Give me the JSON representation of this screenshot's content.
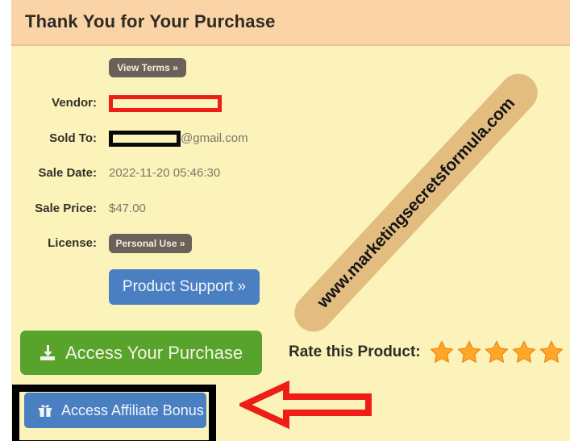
{
  "page": {
    "background_color": "#ffffff",
    "card_background": "#fbf3b9",
    "header_background": "#fad4a7"
  },
  "header": {
    "title": "Thank You for Your Purchase"
  },
  "terms": {
    "label": "View Terms »"
  },
  "details": {
    "rows": [
      {
        "label": "Vendor:",
        "value": "",
        "redacted": "red-box"
      },
      {
        "label": "Sold To:",
        "value": "@gmail.com",
        "redacted": "black-box"
      },
      {
        "label": "Sale Date:",
        "value": "2022-11-20 05:46:30",
        "redacted": ""
      },
      {
        "label": "Sale Price:",
        "value": "$47.00",
        "redacted": ""
      },
      {
        "label": "License:",
        "value": "Personal Use »",
        "redacted": ""
      }
    ]
  },
  "buttons": {
    "product_support": {
      "label": "Product Support »",
      "color": "#4a7fc1"
    },
    "access_purchase": {
      "label": "Access Your Purchase",
      "icon": "download-icon",
      "color": "#57a32c"
    },
    "access_bonus": {
      "label": "Access Affiliate Bonus",
      "icon": "gift-icon",
      "color": "#4a7fc1"
    }
  },
  "rating": {
    "label": "Rate this Product:",
    "star_count": 5,
    "star_color": "#ffa726"
  },
  "watermark": {
    "text": "www.marketingsecretsformula.com",
    "band_color": "#e3bd80"
  },
  "annotations": {
    "highlight_rect_color": "#000000",
    "arrow_color": "#ee1d15"
  }
}
